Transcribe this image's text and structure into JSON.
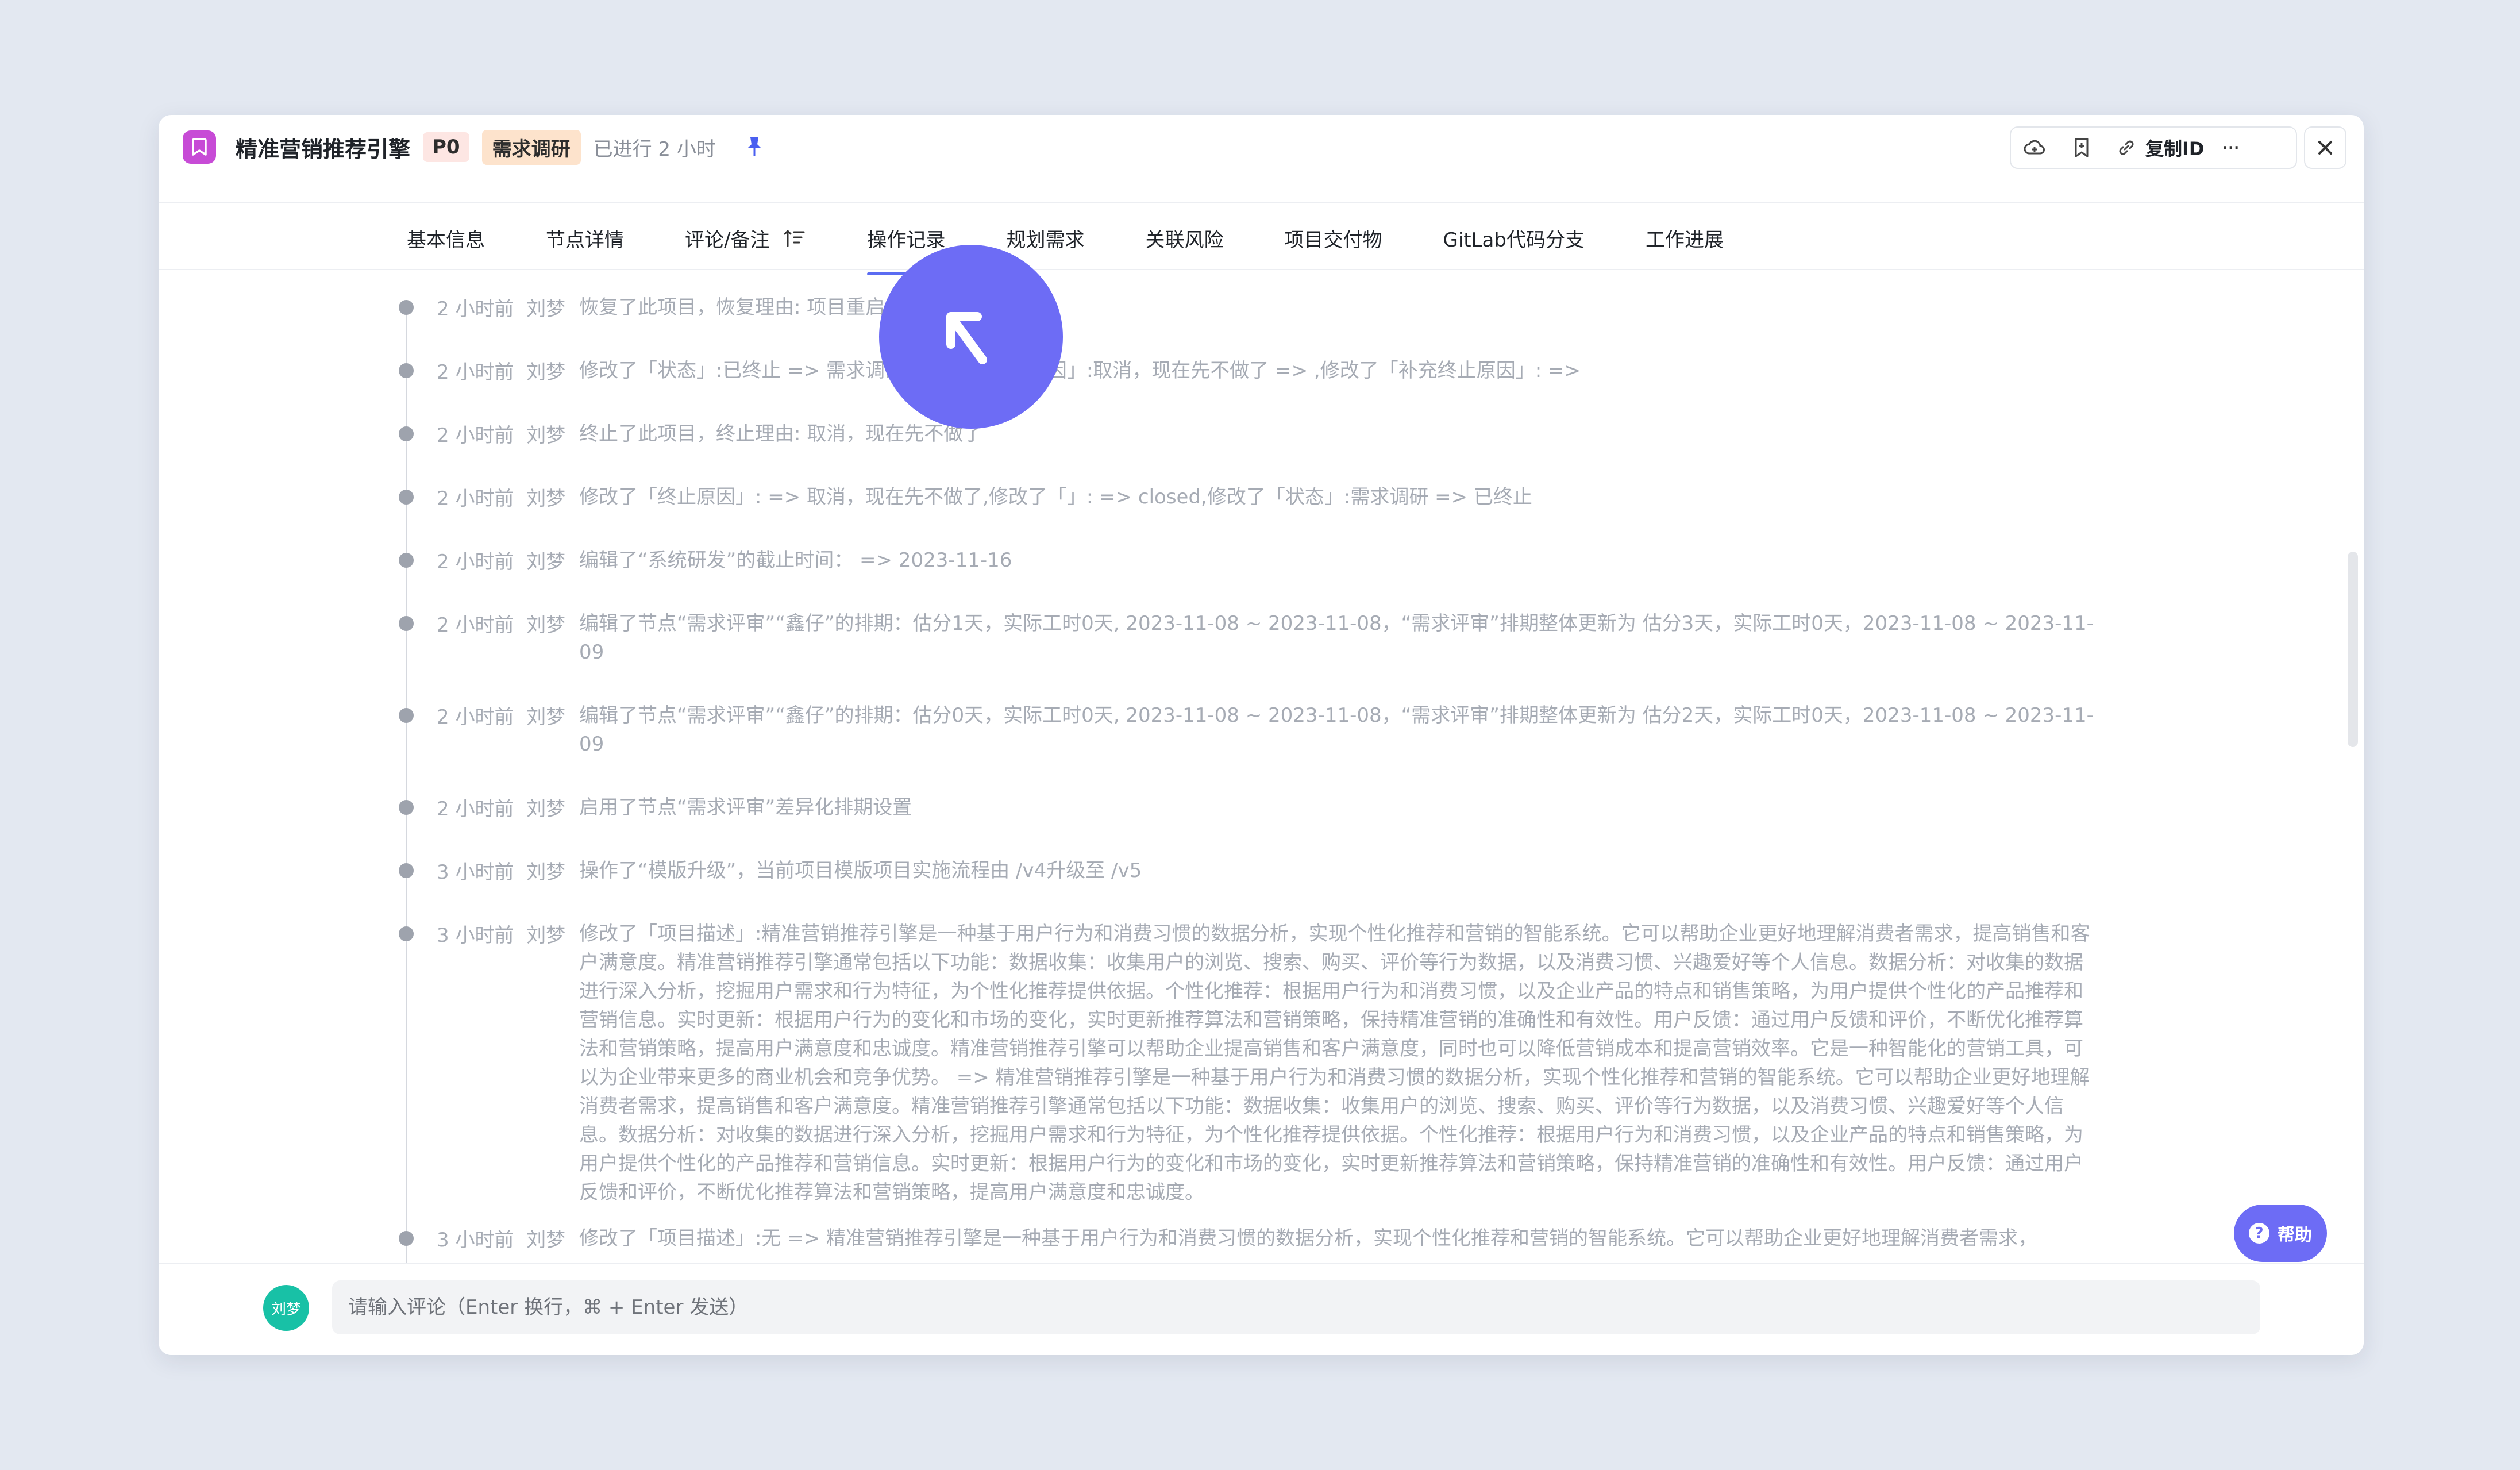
{
  "header": {
    "title": "精准营销推荐引擎",
    "priority": "P0",
    "stage": "需求调研",
    "elapsed": "已进行 2 小时",
    "copy_id_label": "复制ID",
    "more_label": "···"
  },
  "tabs": [
    {
      "label": "基本信息"
    },
    {
      "label": "节点详情"
    },
    {
      "label": "评论/备注"
    },
    {
      "label": "操作记录"
    },
    {
      "label": "规划需求"
    },
    {
      "label": "关联风险"
    },
    {
      "label": "项目交付物"
    },
    {
      "label": "GitLab代码分支"
    },
    {
      "label": "工作进展"
    }
  ],
  "active_tab": "操作记录",
  "logs": [
    {
      "time": "2 小时前",
      "user": "刘梦",
      "action": "恢复了此项目，恢复理由: 项目重启"
    },
    {
      "time": "2 小时前",
      "user": "刘梦",
      "action": "修改了「状态」:已终止 => 需求调研,修改了「终止原因」:取消，现在先不做了 => ,修改了「补充终止原因」: =>"
    },
    {
      "time": "2 小时前",
      "user": "刘梦",
      "action": "终止了此项目，终止理由: 取消，现在先不做了"
    },
    {
      "time": "2 小时前",
      "user": "刘梦",
      "action": "修改了「终止原因」: => 取消，现在先不做了,修改了「」: => closed,修改了「状态」:需求调研 => 已终止"
    },
    {
      "time": "2 小时前",
      "user": "刘梦",
      "action": "编辑了“系统研发”的截止时间： => 2023-11-16"
    },
    {
      "time": "2 小时前",
      "user": "刘梦",
      "action": "编辑了节点“需求评审”“鑫仔”的排期：估分1天，实际工时0天, 2023-11-08 ~ 2023-11-08，“需求评审”排期整体更新为 估分3天，实际工时0天，2023-11-08 ~ 2023-11-09"
    },
    {
      "time": "2 小时前",
      "user": "刘梦",
      "action": "编辑了节点“需求评审”“鑫仔”的排期：估分0天，实际工时0天, 2023-11-08 ~ 2023-11-08，“需求评审”排期整体更新为 估分2天，实际工时0天，2023-11-08 ~ 2023-11-09"
    },
    {
      "time": "2 小时前",
      "user": "刘梦",
      "action": "启用了节点“需求评审”差异化排期设置"
    },
    {
      "time": "3 小时前",
      "user": "刘梦",
      "action": "操作了“模版升级”，当前项目模版项目实施流程由 /v4升级至 /v5"
    },
    {
      "time": "3 小时前",
      "user": "刘梦",
      "action": "修改了「项目描述」:精准营销推荐引擎是一种基于用户行为和消费习惯的数据分析，实现个性化推荐和营销的智能系统。它可以帮助企业更好地理解消费者需求，提高销售和客户满意度。精准营销推荐引擎通常包括以下功能：数据收集：收集用户的浏览、搜索、购买、评价等行为数据，以及消费习惯、兴趣爱好等个人信息。数据分析：对收集的数据进行深入分析，挖掘用户需求和行为特征，为个性化推荐提供依据。个性化推荐：根据用户行为和消费习惯，以及企业产品的特点和销售策略，为用户提供个性化的产品推荐和营销信息。实时更新：根据用户行为的变化和市场的变化，实时更新推荐算法和营销策略，保持精准营销的准确性和有效性。用户反馈：通过用户反馈和评价，不断优化推荐算法和营销策略，提高用户满意度和忠诚度。精准营销推荐引擎可以帮助企业提高销售和客户满意度，同时也可以降低营销成本和提高营销效率。它是一种智能化的营销工具，可以为企业带来更多的商业机会和竞争优势。 => 精准营销推荐引擎是一种基于用户行为和消费习惯的数据分析，实现个性化推荐和营销的智能系统。它可以帮助企业更好地理解消费者需求，提高销售和客户满意度。精准营销推荐引擎通常包括以下功能：数据收集：收集用户的浏览、搜索、购买、评价等行为数据，以及消费习惯、兴趣爱好等个人信息。数据分析：对收集的数据进行深入分析，挖掘用户需求和行为特征，为个性化推荐提供依据。个性化推荐：根据用户行为和消费习惯，以及企业产品的特点和销售策略，为用户提供个性化的产品推荐和营销信息。实时更新：根据用户行为的变化和市场的变化，实时更新推荐算法和营销策略，保持精准营销的准确性和有效性。用户反馈：通过用户反馈和评价，不断优化推荐算法和营销策略，提高用户满意度和忠诚度。"
    },
    {
      "time": "3 小时前",
      "user": "刘梦",
      "action": "修改了「项目描述」:无 => 精准营销推荐引擎是一种基于用户行为和消费习惯的数据分析，实现个性化推荐和营销的智能系统。它可以帮助企业更好地理解消费者需求，"
    }
  ],
  "help_label": "帮助",
  "comment": {
    "avatar_text": "刘梦",
    "placeholder": "请输入评论（Enter 换行，⌘ + Enter 发送）"
  },
  "colors": {
    "accent": "#6d6cf5",
    "tab_underline": "#5b6cf2",
    "title_icon": "#c74bd6",
    "avatar": "#18c1a6"
  }
}
